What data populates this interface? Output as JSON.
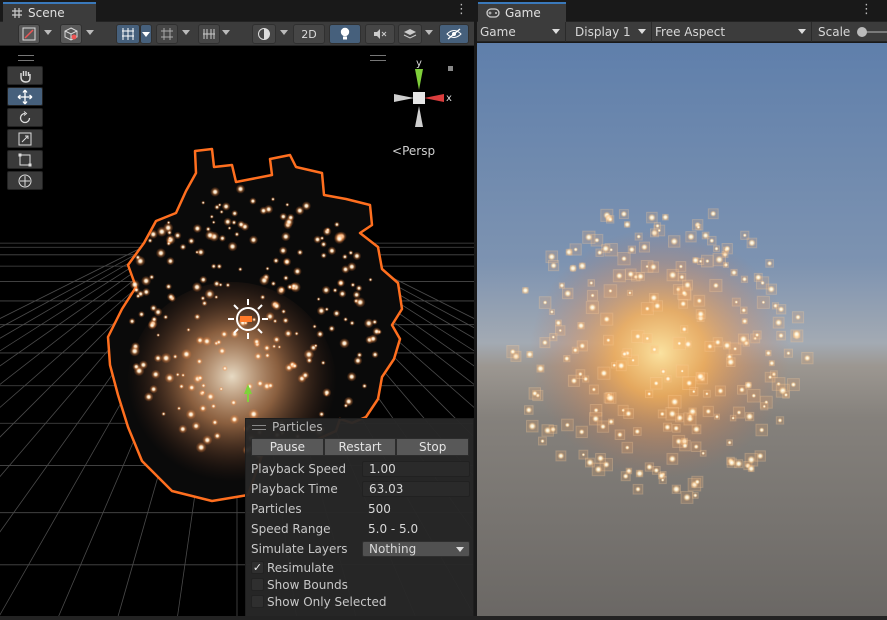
{
  "scene": {
    "tab_label": "Scene",
    "toggle_2d_label": "2D",
    "persp_label": "Persp",
    "gizmo": {
      "y_label": "y",
      "x_label": "x"
    }
  },
  "particles_panel": {
    "title": "Particles",
    "buttons": {
      "pause": "Pause",
      "restart": "Restart",
      "stop": "Stop"
    },
    "playback_speed": {
      "label": "Playback Speed",
      "value": "1.00"
    },
    "playback_time": {
      "label": "Playback Time",
      "value": "63.03"
    },
    "particles": {
      "label": "Particles",
      "value": "500"
    },
    "speed_range": {
      "label": "Speed Range",
      "value": "5.0 - 5.0"
    },
    "simulate_layers": {
      "label": "Simulate Layers",
      "value": "Nothing"
    },
    "resimulate": {
      "label": "Resimulate",
      "checked": true
    },
    "show_bounds": {
      "label": "Show Bounds",
      "checked": false
    },
    "show_only_selected": {
      "label": "Show Only Selected",
      "checked": false
    }
  },
  "game": {
    "tab_label": "Game",
    "mode_dropdown": "Game",
    "display_dropdown": "Display 1",
    "aspect_dropdown": "Free Aspect",
    "scale_label": "Scale"
  },
  "colors": {
    "accent_blue": "#3a79bb",
    "selection_outline": "#ff6f1f",
    "panel_bg": "#3c3c3c"
  }
}
